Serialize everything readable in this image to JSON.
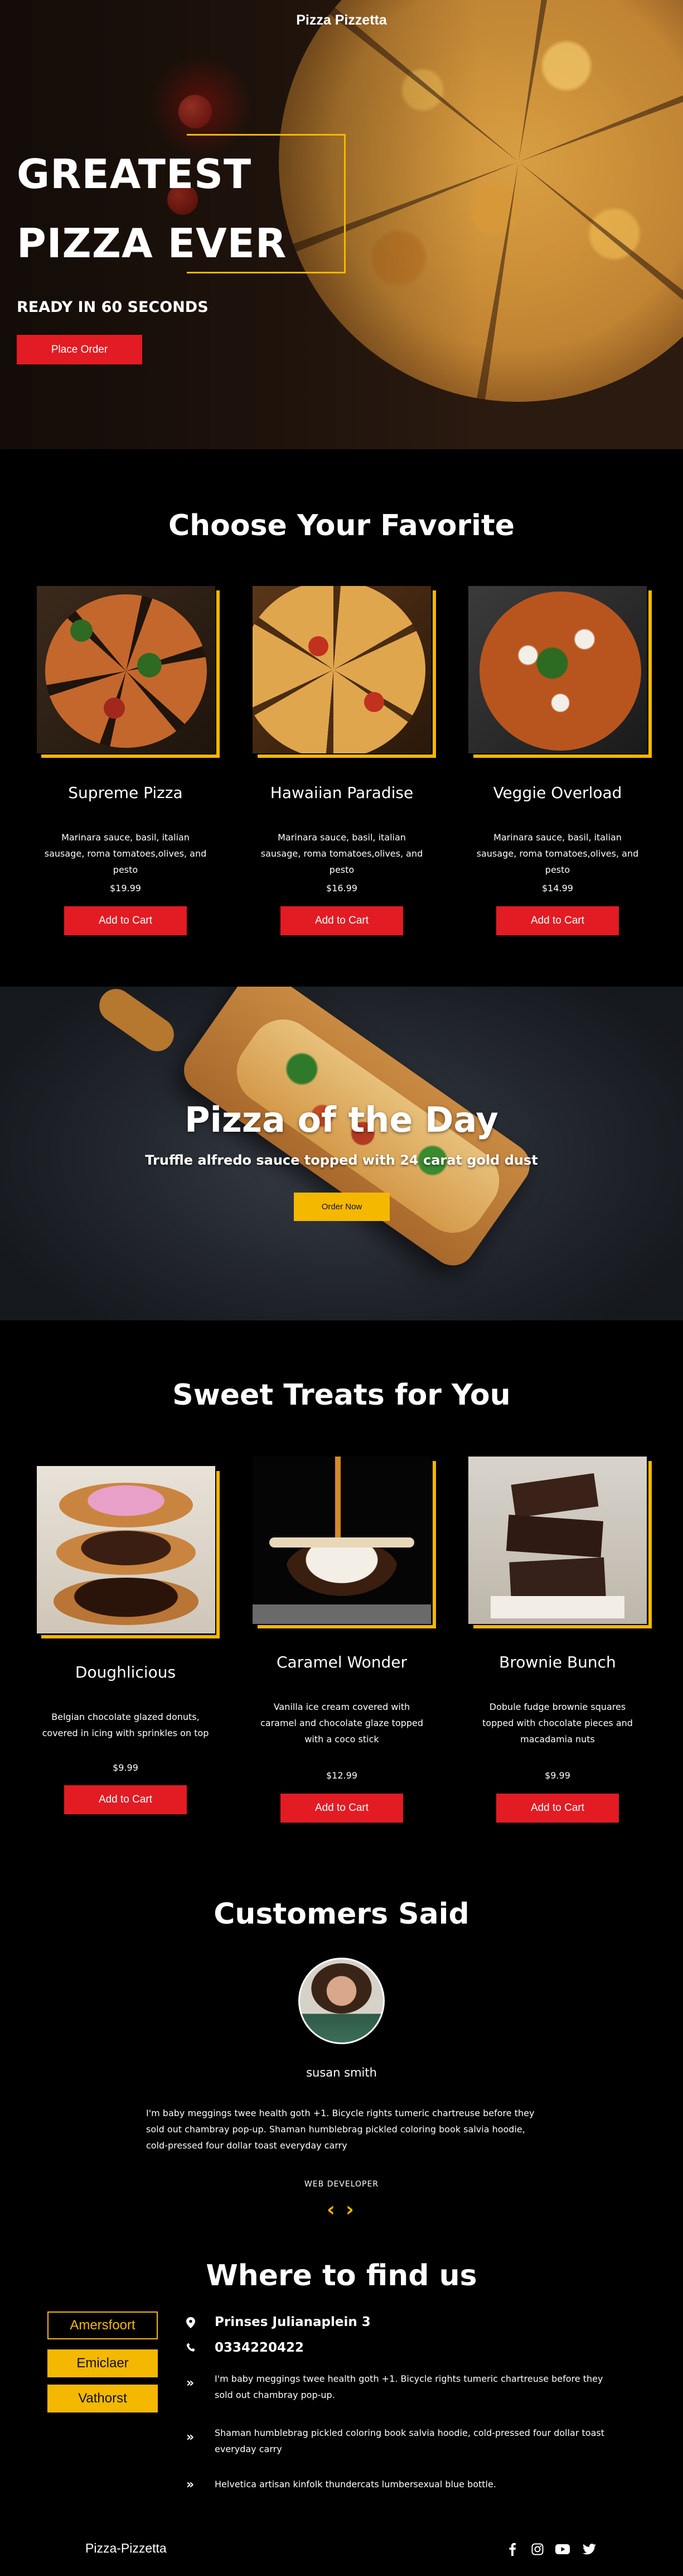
{
  "brand": "Pizza Pizzetta",
  "hero": {
    "title_line1": "GREATEST",
    "title_line2": "PIZZA EVER",
    "subtitle": "READY IN 60 SECONDS",
    "cta": "Place Order"
  },
  "favorites": {
    "heading": "Choose Your Favorite",
    "items": [
      {
        "name": "Supreme Pizza",
        "desc": "Marinara sauce, basil, italian sausage, roma tomatoes,olives, and pesto",
        "price": "$19.99",
        "button": "Add to Cart"
      },
      {
        "name": "Hawaiian Paradise",
        "desc": "Marinara sauce, basil, italian sausage, roma tomatoes,olives, and pesto",
        "price": "$16.99",
        "button": "Add to Cart"
      },
      {
        "name": "Veggie Overload",
        "desc": "Marinara sauce, basil, italian sausage, roma tomatoes,olives, and pesto",
        "price": "$14.99",
        "button": "Add to Cart"
      }
    ]
  },
  "pizza_of_day": {
    "title": "Pizza of the Day",
    "subtitle": "Truffle alfredo sauce topped with 24 carat gold dust",
    "button": "Order Now"
  },
  "sweets": {
    "heading": "Sweet Treats for You",
    "items": [
      {
        "name": "Doughlicious",
        "desc": "Belgian chocolate glazed donuts, covered in icing with sprinkles on top",
        "price": "$9.99",
        "button": "Add to Cart"
      },
      {
        "name": "Caramel Wonder",
        "desc": "Vanilla ice cream covered with caramel and chocolate glaze topped with a coco stick",
        "price": "$12.99",
        "button": "Add to Cart"
      },
      {
        "name": "Brownie Bunch",
        "desc": "Dobule fudge brownie squares topped with chocolate pieces and macadamia nuts",
        "price": "$9.99",
        "button": "Add to Cart"
      }
    ]
  },
  "testimonials": {
    "heading": "Customers Said",
    "name": "susan smith",
    "text": "I'm baby meggings twee health goth +1. Bicycle rights tumeric chartreuse before they sold out chambray pop-up. Shaman humblebrag pickled coloring book salvia hoodie, cold-pressed four dollar toast everyday carry",
    "role": "WEB DEVELOPER",
    "prev": "‹",
    "next": "›"
  },
  "find_us": {
    "heading": "Where to find us",
    "locations": [
      "Amersfoort",
      "Emiclaer",
      "Vathorst"
    ],
    "address": "Prinses Julianaplein 3",
    "phone": "0334220422",
    "lines": [
      "I'm baby meggings twee health goth +1. Bicycle rights tumeric chartreuse before they sold out chambray pop-up.",
      "Shaman humblebrag pickled coloring book salvia hoodie, cold-pressed four dollar toast everyday carry",
      "Helvetica artisan kinfolk thundercats lumbersexual blue bottle."
    ]
  },
  "footer": {
    "brand": "Pizza-Pizzetta",
    "social": [
      "facebook-icon",
      "instagram-icon",
      "youtube-icon",
      "twitter-icon"
    ]
  },
  "colors": {
    "accent_red": "#e31b23",
    "accent_yellow": "#f5b800",
    "background": "#000000"
  }
}
